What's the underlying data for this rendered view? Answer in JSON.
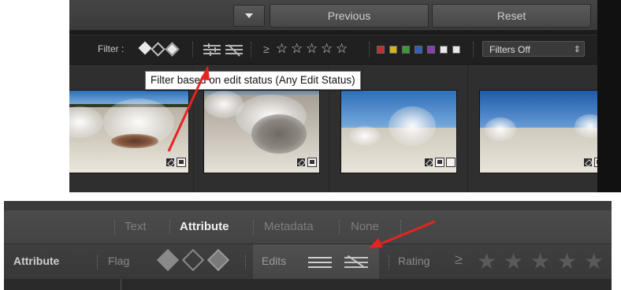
{
  "top": {
    "toolbar": {
      "previous_label": "Previous",
      "reset_label": "Reset"
    },
    "filter_bar": {
      "label": "Filter :",
      "rating_operator": "≥",
      "stars": [
        "☆",
        "☆",
        "☆",
        "☆",
        "☆"
      ],
      "color_labels": [
        "#c0302b",
        "#d4b31f",
        "#3a9a3a",
        "#2f5fb8",
        "#8a3fb0",
        "#e8e8e8",
        "#e8e8e8"
      ],
      "filters_value": "Filters Off"
    },
    "tooltip": "Filter based on edit status (Any Edit Status)"
  },
  "bottom": {
    "tabs": [
      "Text",
      "Attribute",
      "Metadata",
      "None"
    ],
    "active_tab": "Attribute",
    "attribute_row": {
      "title": "Attribute",
      "flag_label": "Flag",
      "edits_label": "Edits",
      "rating_label": "Rating",
      "rating_operator": "≥",
      "stars": [
        "★",
        "★",
        "★",
        "★",
        "★"
      ]
    }
  },
  "colors": {
    "arrow": "#e52421",
    "tooltip_bg": "#ffffff"
  }
}
